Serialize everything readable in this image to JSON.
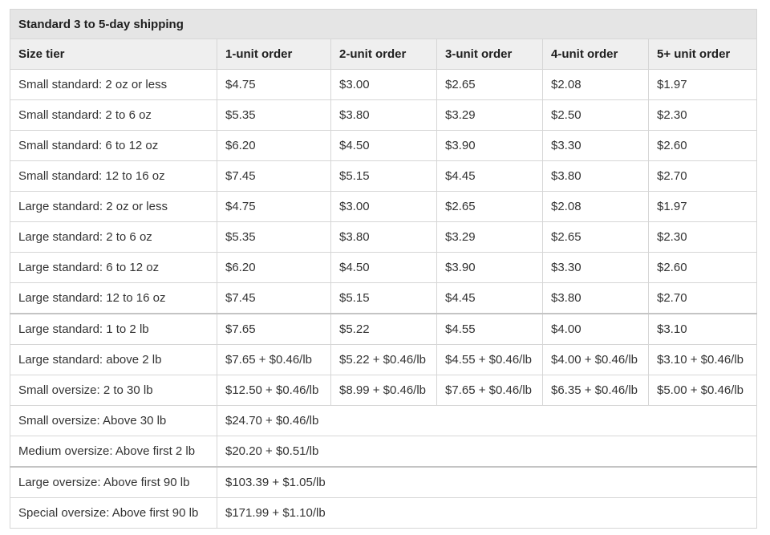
{
  "caption": "Standard 3 to 5-day shipping",
  "columns": [
    "Size tier",
    "1-unit order",
    "2-unit order",
    "3-unit order",
    "4-unit order",
    "5+ unit order"
  ],
  "rows": [
    {
      "tier": "Small standard: 2 oz or less",
      "prices": [
        "$4.75",
        "$3.00",
        "$2.65",
        "$2.08",
        "$1.97"
      ]
    },
    {
      "tier": "Small standard: 2 to 6 oz",
      "prices": [
        "$5.35",
        "$3.80",
        "$3.29",
        "$2.50",
        "$2.30"
      ]
    },
    {
      "tier": "Small standard: 6 to 12 oz",
      "prices": [
        "$6.20",
        "$4.50",
        "$3.90",
        "$3.30",
        "$2.60"
      ]
    },
    {
      "tier": "Small standard: 12 to 16 oz",
      "prices": [
        "$7.45",
        "$5.15",
        "$4.45",
        "$3.80",
        "$2.70"
      ]
    },
    {
      "tier": "Large standard: 2 oz or less",
      "prices": [
        "$4.75",
        "$3.00",
        "$2.65",
        "$2.08",
        "$1.97"
      ]
    },
    {
      "tier": "Large standard: 2 to 6 oz",
      "prices": [
        "$5.35",
        "$3.80",
        "$3.29",
        "$2.65",
        "$2.30"
      ]
    },
    {
      "tier": "Large standard: 6 to 12 oz",
      "prices": [
        "$6.20",
        "$4.50",
        "$3.90",
        "$3.30",
        "$2.60"
      ]
    },
    {
      "tier": "Large standard: 12 to 16 oz",
      "prices": [
        "$7.45",
        "$5.15",
        "$4.45",
        "$3.80",
        "$2.70"
      ]
    },
    {
      "tier": "Large standard: 1 to 2 lb",
      "prices": [
        "$7.65",
        "$5.22",
        "$4.55",
        "$4.00",
        "$3.10"
      ]
    },
    {
      "tier": "Large standard: above 2 lb",
      "prices": [
        "$7.65 + $0.46/lb",
        "$5.22 + $0.46/lb",
        "$4.55 + $0.46/lb",
        "$4.00 + $0.46/lb",
        "$3.10 + $0.46/lb"
      ]
    },
    {
      "tier": "Small oversize: 2 to 30 lb",
      "prices": [
        "$12.50 + $0.46/lb",
        "$8.99 + $0.46/lb",
        "$7.65 + $0.46/lb",
        "$6.35 + $0.46/lb",
        "$5.00 + $0.46/lb"
      ]
    },
    {
      "tier": "Small oversize: Above 30 lb",
      "prices": [
        "$24.70 + $0.46/lb"
      ]
    },
    {
      "tier": "Medium oversize: Above first 2 lb",
      "prices": [
        "$20.20 + $0.51/lb"
      ]
    },
    {
      "tier": "Large oversize: Above first 90 lb",
      "prices": [
        "$103.39 + $1.05/lb"
      ]
    },
    {
      "tier": "Special oversize: Above first 90 lb",
      "prices": [
        "$171.99 + $1.10/lb"
      ]
    }
  ]
}
